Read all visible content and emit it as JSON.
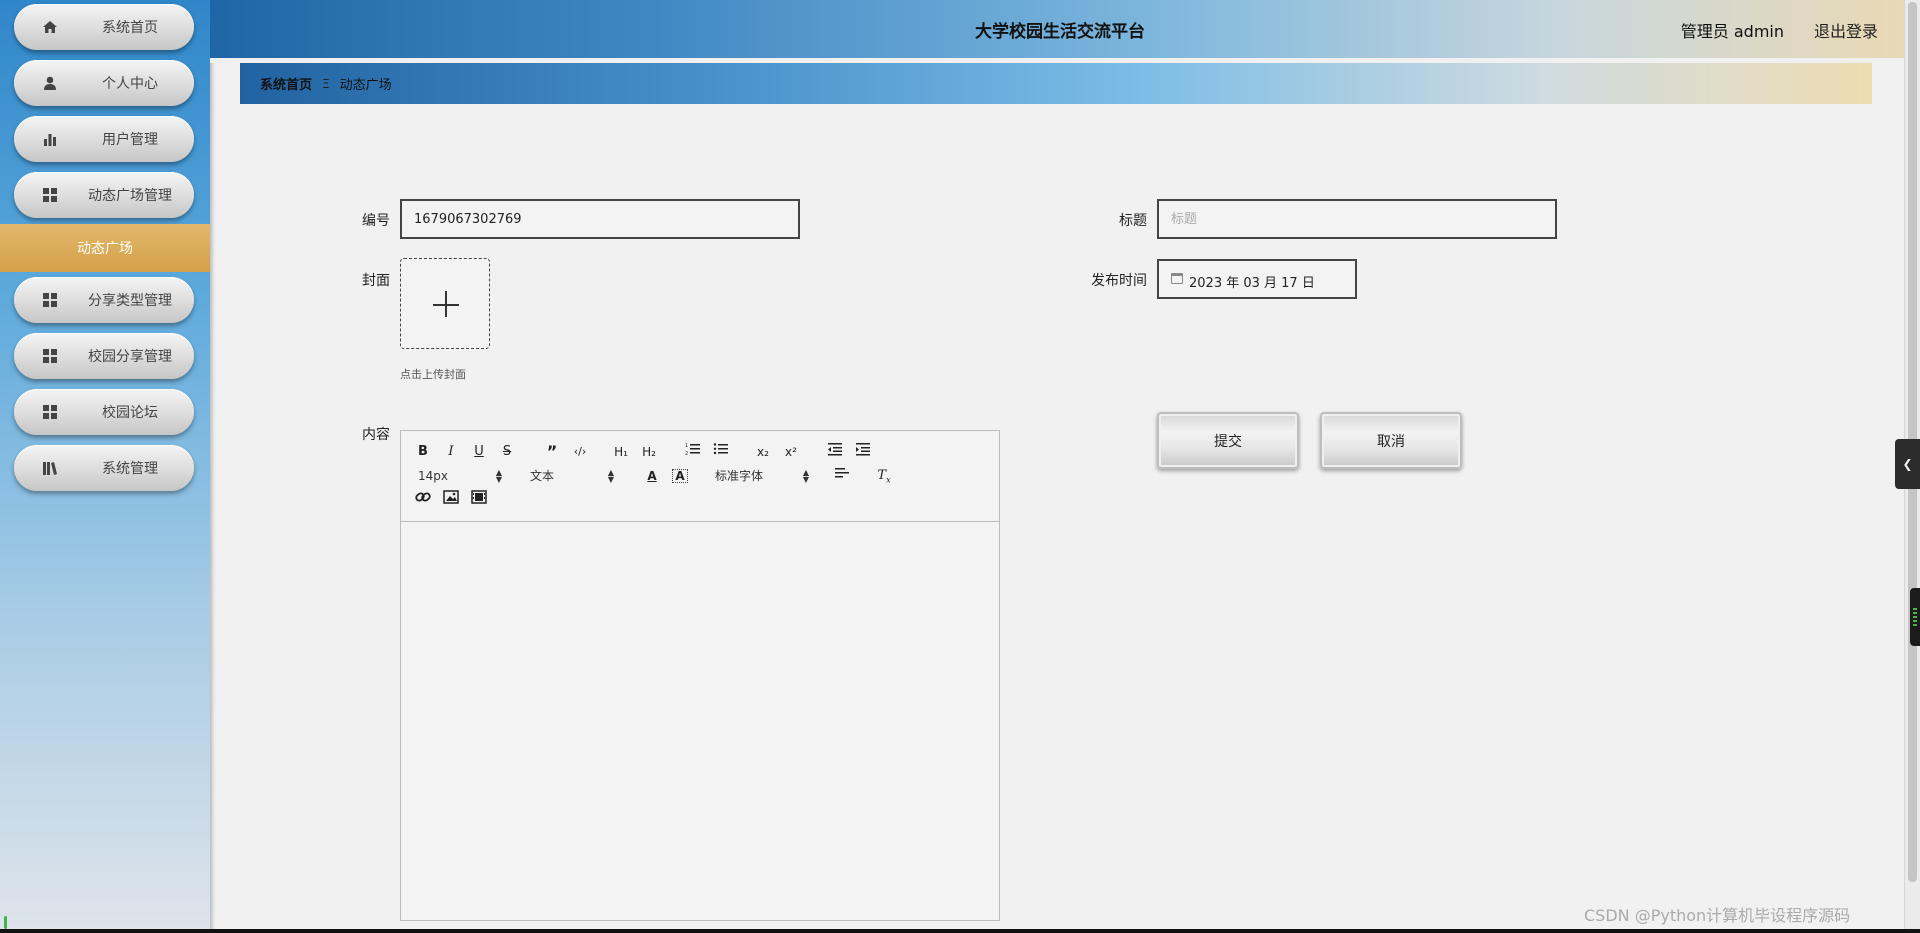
{
  "app": {
    "title": "大学校园生活交流平台"
  },
  "header": {
    "user": "管理员 admin",
    "logout": "退出登录"
  },
  "sidebar": {
    "items": [
      {
        "label": "系统首页",
        "icon": "home-icon"
      },
      {
        "label": "个人中心",
        "icon": "user-icon"
      },
      {
        "label": "用户管理",
        "icon": "bar-chart-icon"
      },
      {
        "label": "动态广场管理",
        "icon": "grid-icon"
      },
      {
        "label": "分享类型管理",
        "icon": "grid-icon"
      },
      {
        "label": "校园分享管理",
        "icon": "grid-icon"
      },
      {
        "label": "校园论坛",
        "icon": "grid-icon"
      },
      {
        "label": "系统管理",
        "icon": "library-icon"
      }
    ],
    "active_sub": "动态广场"
  },
  "breadcrumb": {
    "home": "系统首页",
    "separator": "Ξ",
    "current": "动态广场"
  },
  "form": {
    "number": {
      "label": "编号",
      "value": "1679067302769"
    },
    "title": {
      "label": "标题",
      "placeholder": "标题",
      "value": ""
    },
    "cover": {
      "label": "封面",
      "hint": "点击上传封面"
    },
    "publish_time": {
      "label": "发布时间",
      "value": "2023 年 03 月 17 日"
    },
    "content": {
      "label": "内容"
    }
  },
  "editor": {
    "font_size": "14px",
    "block_format": "文本",
    "font_family": "标准字体"
  },
  "buttons": {
    "submit": "提交",
    "cancel": "取消"
  },
  "watermark": "CSDN @Python计算机毕设程序源码",
  "colors": {
    "accent_gold": "#d4a04a",
    "header_blue": "#1f66a6"
  }
}
